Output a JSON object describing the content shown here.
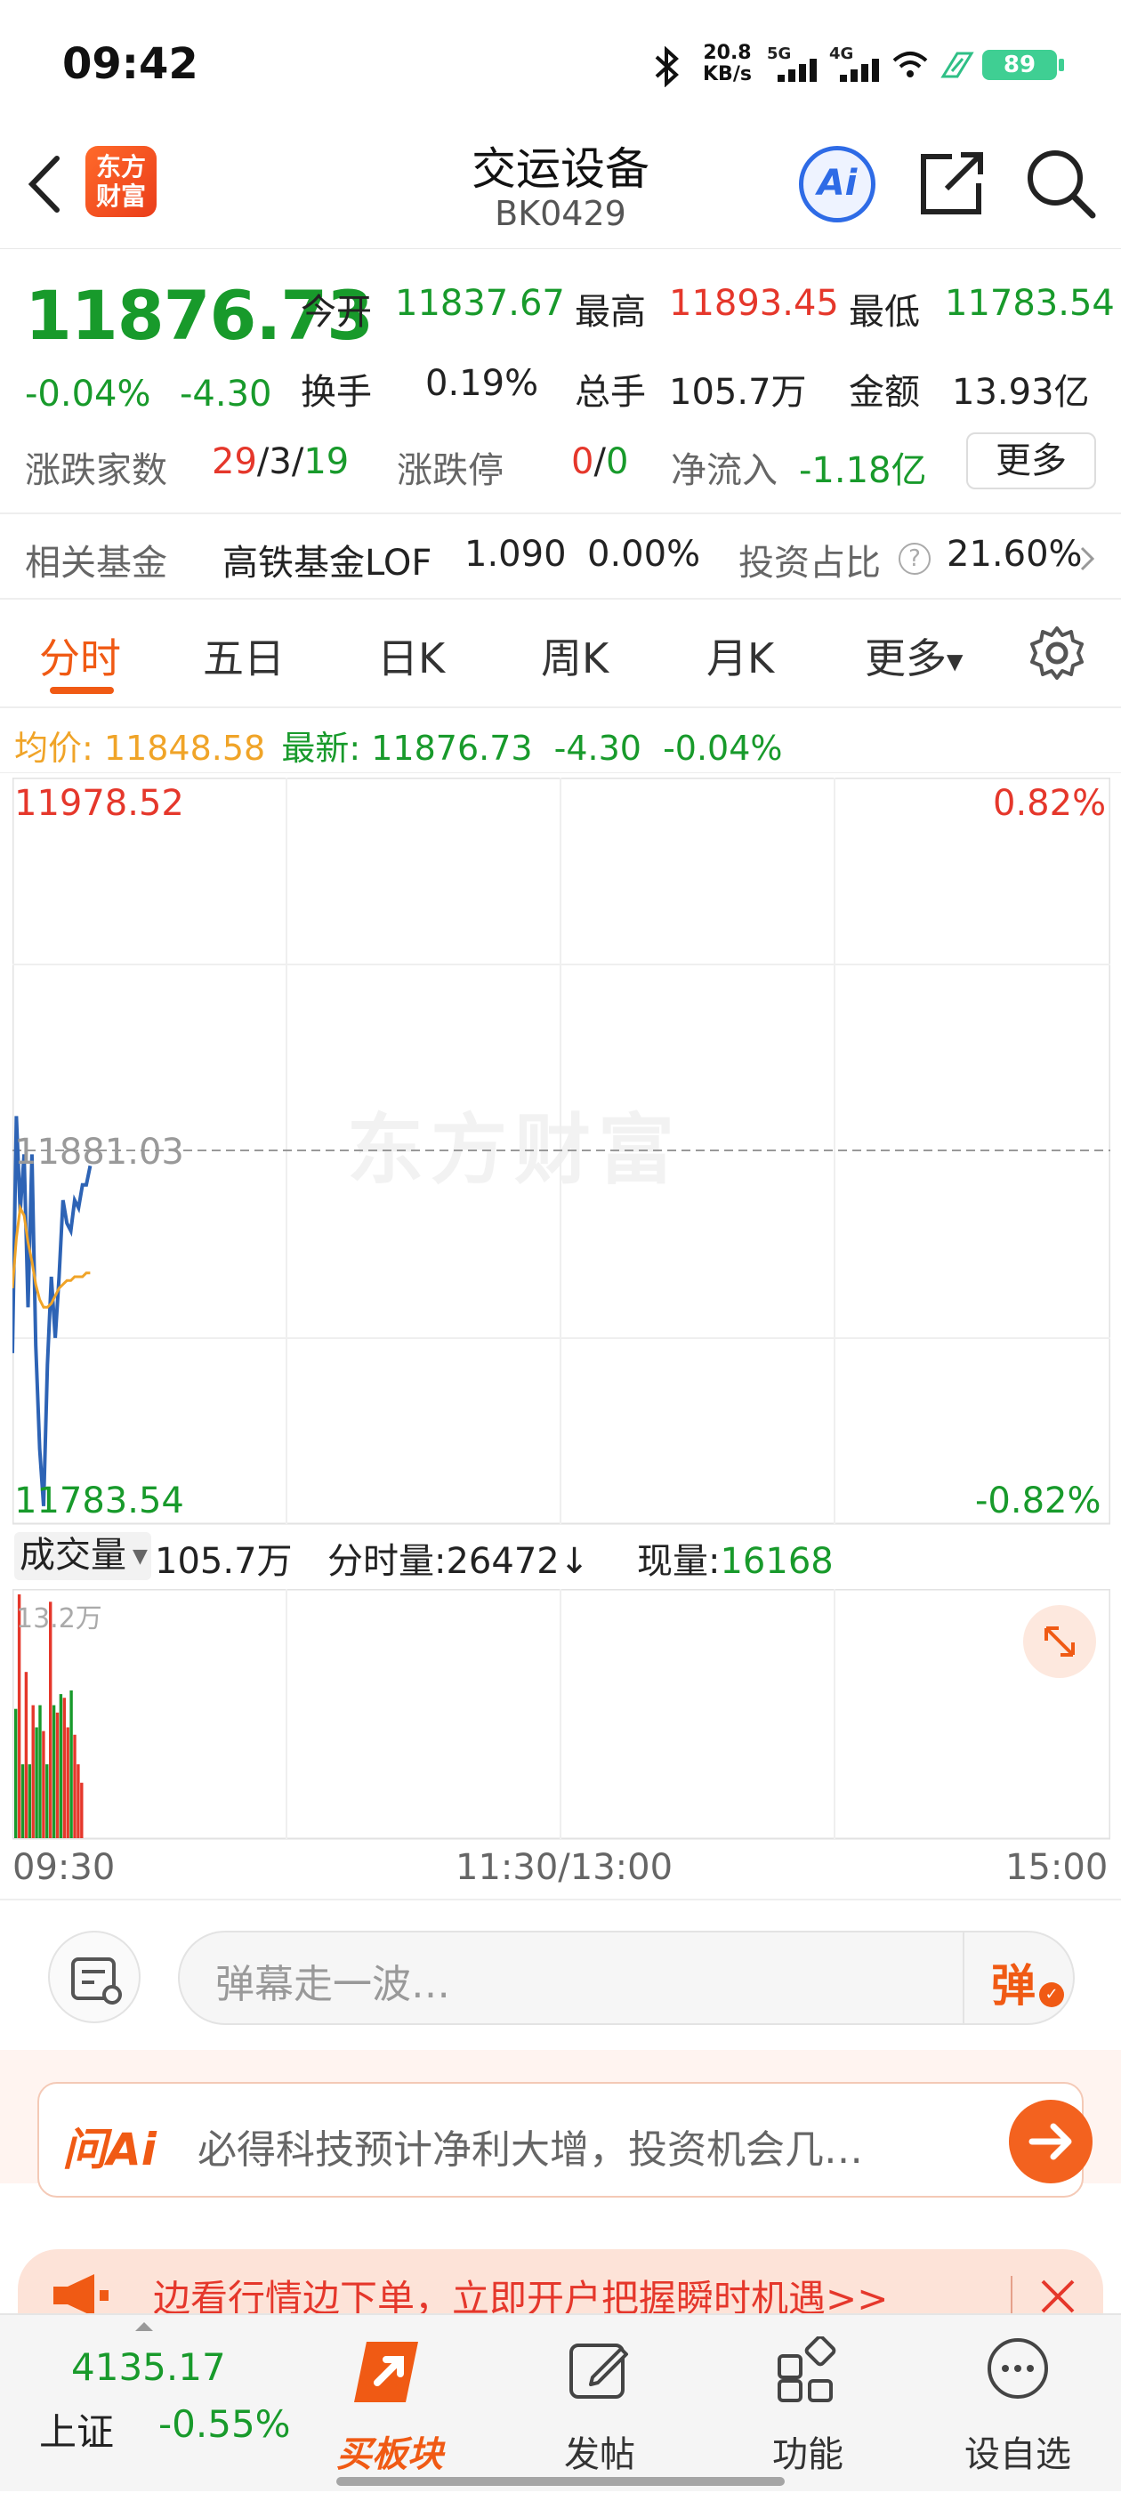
{
  "status_bar": {
    "time": "09:42",
    "net_speed_value": "20.8",
    "net_speed_unit": "KB/s",
    "signal1_label": "5G",
    "signal2_label": "4G",
    "battery": "89"
  },
  "header": {
    "logo_line1": "东方",
    "logo_line2": "财富",
    "title": "交运设备",
    "code": "BK0429",
    "ai_label": "Ai"
  },
  "quote": {
    "price": "11876.73",
    "change_pct": "-0.04%",
    "change": "-4.30",
    "open_label": "今开",
    "open": "11837.67",
    "high_label": "最高",
    "high": "11893.45",
    "low_label": "最低",
    "low": "11783.54",
    "turnover_label": "换手",
    "turnover": "0.19%",
    "volume_label": "总手",
    "volume": "105.7万",
    "amount_label": "金额",
    "amount": "13.93亿",
    "updown_label": "涨跌家数",
    "up_count": "29",
    "slash1": "/",
    "flat_count": "3",
    "slash2": "/",
    "down_count": "19",
    "limit_label": "涨跌停",
    "limit_up": "0",
    "slash3": "/",
    "limit_down": "0",
    "netflow_label": "净流入",
    "netflow": "-1.18亿",
    "more_label": "更多"
  },
  "fund": {
    "label": "相关基金",
    "name": "高铁基金LOF",
    "price": "1.090",
    "pct": "0.00%",
    "ratio_label": "投资占比",
    "ratio": "21.60%"
  },
  "tabs": [
    "分时",
    "五日",
    "日K",
    "周K",
    "月K",
    "更多"
  ],
  "chart_info": {
    "avg_label": "均价:",
    "avg": "11848.58",
    "latest_label": "最新:",
    "latest": "11876.73",
    "latest_change": "-4.30",
    "latest_pct": "-0.04%"
  },
  "colors": {
    "up": "#e5372b",
    "down": "#189a2b",
    "accent": "#f05a14",
    "price_line": "#2d63b5",
    "avg_line": "#f0a428"
  },
  "chart_data": [
    {
      "type": "line",
      "title": "",
      "y_top_label": "11978.52",
      "y_mid_label": "11881.03",
      "y_bottom_label": "11783.54",
      "pct_top_label": "0.82%",
      "pct_bottom_label": "-0.82%",
      "ylim": [
        11783.54,
        11978.52
      ],
      "reference": 11881.03,
      "x_labels": [
        "09:30",
        "11:30/13:00",
        "15:00"
      ],
      "series": [
        {
          "values": [
            11828,
            11890,
            11865,
            11880,
            11840,
            11880,
            11830,
            11803,
            11788,
            11825,
            11848,
            11832,
            11848,
            11868,
            11862,
            11860,
            11868,
            11866,
            11872,
            11872,
            11877
          ]
        },
        {
          "values": [
            11845,
            11858,
            11866,
            11864,
            11857,
            11852,
            11846,
            11842,
            11840,
            11840,
            11841,
            11843,
            11845,
            11846,
            11847,
            11847,
            11848,
            11848,
            11848,
            11849,
            11849
          ]
        }
      ],
      "grid": true,
      "watermark": "东方财富"
    },
    {
      "type": "bar",
      "title": "",
      "volume_label": "成交量",
      "total_volume": "105.7万",
      "minute_volume_label": "分时量:",
      "minute_volume": "26472",
      "minute_volume_arrow": "↓",
      "current_volume_label": "现量:",
      "current_volume": "16168",
      "y_max_label": "13.2万",
      "ylim": [
        0,
        132000
      ],
      "values": [
        70000,
        132000,
        40000,
        90000,
        40000,
        72000,
        60000,
        72000,
        58000,
        40000,
        128000,
        72000,
        68000,
        78000,
        76000,
        60000,
        80000,
        56000,
        40000,
        30000
      ],
      "colors": [
        "down",
        "up",
        "down",
        "up",
        "down",
        "up",
        "down",
        "down",
        "up",
        "down",
        "up",
        "down",
        "up",
        "down",
        "up",
        "up",
        "down",
        "up",
        "up",
        "up"
      ],
      "grid": true
    }
  ],
  "danmu": {
    "placeholder": "弹幕走一波…",
    "send_label": "弹"
  },
  "ai_bar": {
    "brand": "问Ai",
    "text": "必得科技预计净利大增，投资机会几…"
  },
  "ad": {
    "text": "边看行情边下单，立即开户把握瞬时机遇>>"
  },
  "bottom_nav": {
    "index_value": "4135.17",
    "index_name": "上证",
    "index_pct": "-0.55%",
    "buy_label": "买板块",
    "post_label": "发帖",
    "func_label": "功能",
    "fav_label": "设自选"
  }
}
